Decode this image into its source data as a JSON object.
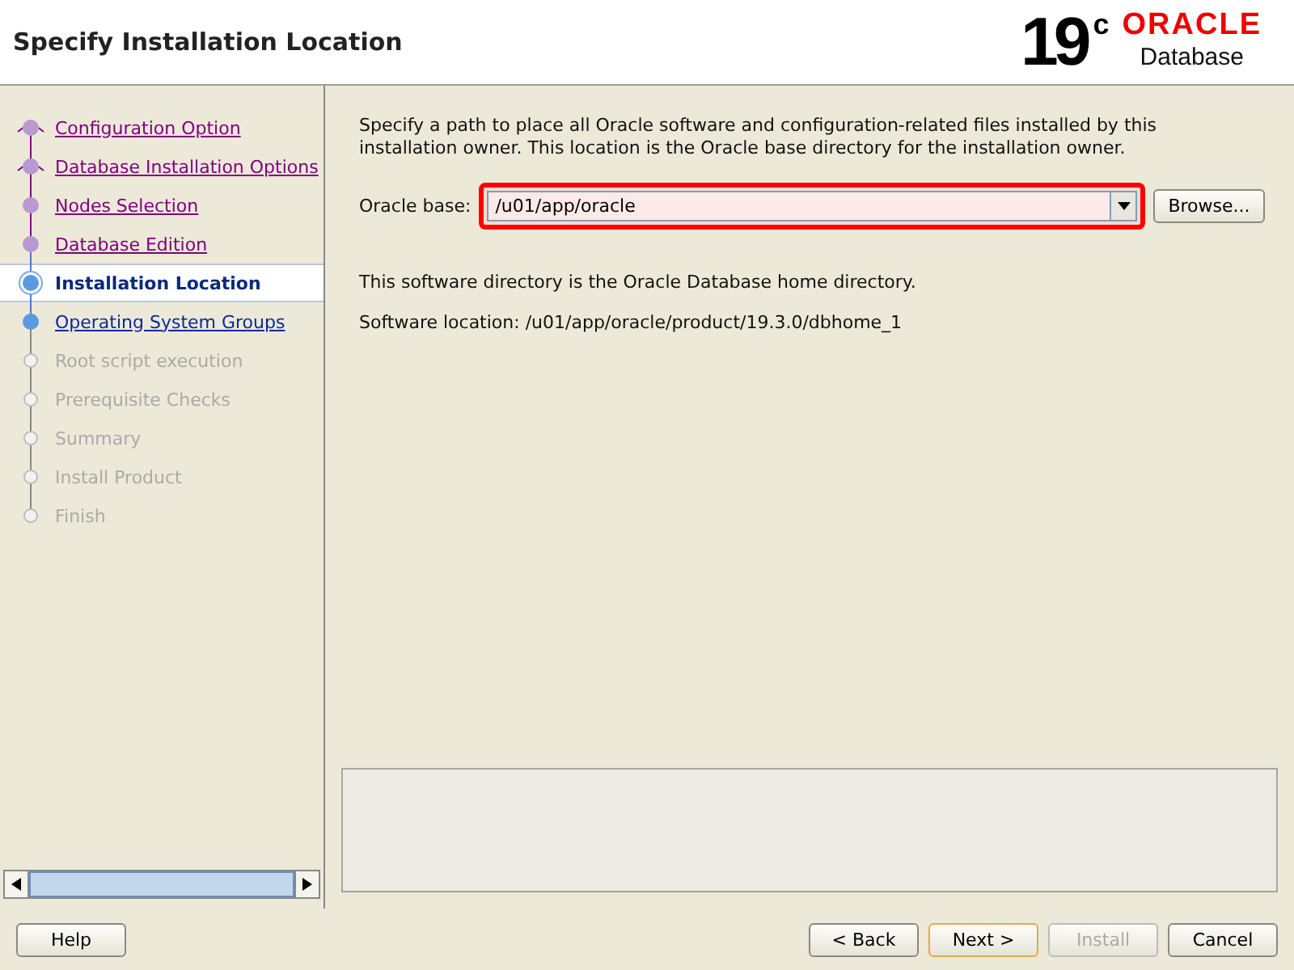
{
  "window": {
    "title": "Specify Installation Location"
  },
  "logo": {
    "version": "19",
    "suffix": "c",
    "brand": "ORACLE",
    "product": "Database"
  },
  "steps": [
    {
      "label": "Configuration Option",
      "kind": "done",
      "selected": false
    },
    {
      "label": "Database Installation Options",
      "kind": "done",
      "selected": false
    },
    {
      "label": "Nodes Selection",
      "kind": "done",
      "selected": false
    },
    {
      "label": "Database Edition",
      "kind": "done",
      "selected": false
    },
    {
      "label": "Installation Location",
      "kind": "current",
      "selected": true
    },
    {
      "label": "Operating System Groups",
      "kind": "next",
      "selected": false
    },
    {
      "label": "Root script execution",
      "kind": "pending",
      "selected": false
    },
    {
      "label": "Prerequisite Checks",
      "kind": "pending",
      "selected": false
    },
    {
      "label": "Summary",
      "kind": "pending",
      "selected": false
    },
    {
      "label": "Install Product",
      "kind": "pending",
      "selected": false
    },
    {
      "label": "Finish",
      "kind": "pending",
      "selected": false
    }
  ],
  "intro": "Specify a path to place all Oracle software and configuration-related files installed by this installation owner. This location is the Oracle base directory for the installation owner.",
  "oracle_base": {
    "label": "Oracle base:",
    "value": "/u01/app/oracle",
    "highlighted": true,
    "browse": "Browse..."
  },
  "home_note": "This software directory is the Oracle Database home directory.",
  "software_location": "Software location: /u01/app/oracle/product/19.3.0/dbhome_1",
  "buttons": [
    {
      "label": "Help",
      "disabled": false,
      "focused": false
    },
    {
      "label": "< Back",
      "disabled": false,
      "focused": false
    },
    {
      "label": "Next >",
      "disabled": false,
      "focused": true
    },
    {
      "label": "Install",
      "disabled": true,
      "focused": false
    },
    {
      "label": "Cancel",
      "disabled": false,
      "focused": false
    }
  ]
}
